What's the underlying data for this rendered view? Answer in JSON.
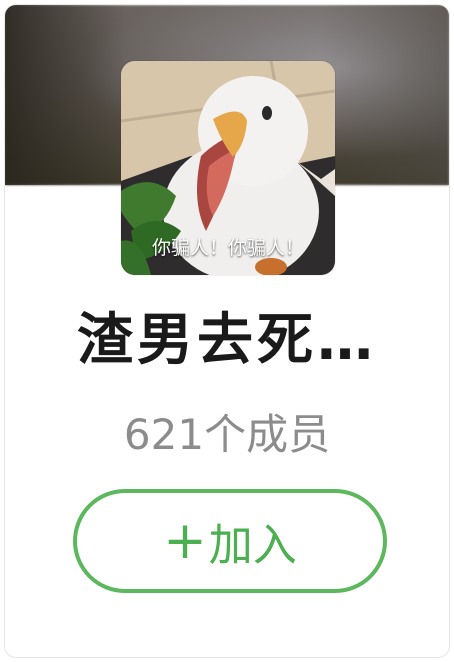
{
  "group_card": {
    "name": "渣男去死…",
    "member_count": "621个成员",
    "avatar_caption": "你骗人！你骗人！",
    "join_button": {
      "icon": "plus-icon",
      "icon_glyph": "+",
      "label": "加入"
    },
    "colors": {
      "join_accent": "#5cb85c",
      "name_text": "#1a1a1a",
      "count_text": "#8c8c8c"
    }
  }
}
